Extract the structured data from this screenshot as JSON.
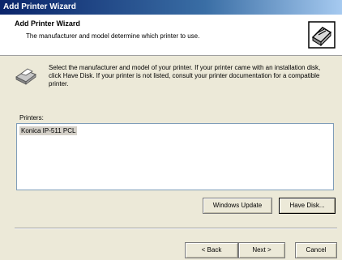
{
  "window": {
    "title": "Add Printer Wizard"
  },
  "header": {
    "title": "Add Printer Wizard",
    "subtitle": "The manufacturer and model determine which printer to use.",
    "icon": "printer-wizard-icon"
  },
  "instruction": {
    "text": "Select the manufacturer and model of your printer. If your printer came with an installation disk, click Have Disk. If your printer is not listed, consult your printer documentation for a compatible printer.",
    "icon": "printer-icon"
  },
  "printers": {
    "label": "Printers:",
    "items": [
      "Konica IP-511 PCL"
    ],
    "selected": "Konica IP-511 PCL"
  },
  "buttons": {
    "windows_update": "Windows Update",
    "have_disk": "Have Disk...",
    "back": "< Back",
    "next": "Next >",
    "cancel": "Cancel"
  }
}
